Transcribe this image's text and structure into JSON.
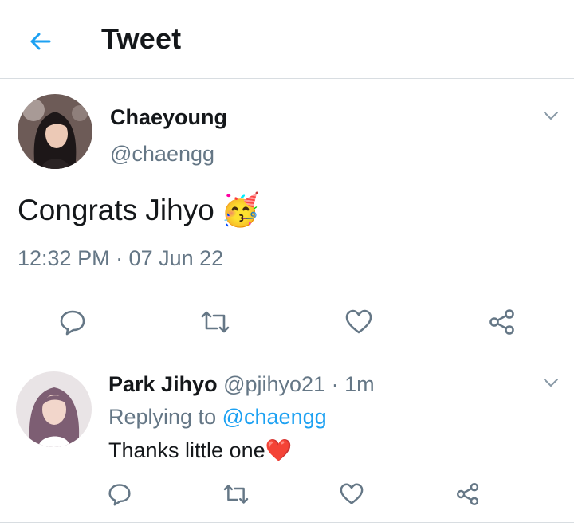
{
  "header": {
    "title": "Tweet",
    "back_icon": "arrow-left-icon",
    "accent": "#1da1f2"
  },
  "tweet": {
    "author_name": "Chaeyoung",
    "author_handle": "@chaengg",
    "text": "Congrats Jihyo",
    "emoji": "🥳",
    "timestamp": "12:32 PM · 07 Jun 22",
    "actions": [
      "reply-icon",
      "retweet-icon",
      "like-icon",
      "share-icon"
    ]
  },
  "reply": {
    "author_name": "Park Jihyo",
    "author_handle": "@pjihyo21",
    "separator": "·",
    "time": "1m",
    "replying_prefix": "Replying to",
    "replying_handle": "@chaengg",
    "text": "Thanks little one",
    "emoji": "❤️",
    "actions": [
      "reply-icon",
      "retweet-icon",
      "like-icon",
      "share-icon"
    ]
  },
  "colors": {
    "text": "#14171a",
    "secondary": "#657786",
    "link": "#1da1f2",
    "divider": "#d8dde1"
  }
}
